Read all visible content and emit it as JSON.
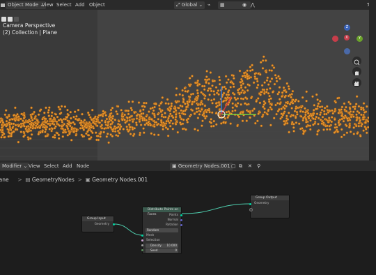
{
  "viewport_header": {
    "mode_label": "Object Mode",
    "menu": [
      "View",
      "Select",
      "Add",
      "Object"
    ],
    "transform_orientation": "Global"
  },
  "viewport": {
    "camera_label": "Camera Perspective",
    "collection_label": "(2) Collection | Plane",
    "gizmo": {
      "x": "X",
      "y": "Y",
      "z": "Z"
    },
    "point_color": "#e8962e",
    "background_color": "#434343"
  },
  "node_editor_header": {
    "editor_type": "Modifier",
    "menu": [
      "View",
      "Select",
      "Add",
      "Node"
    ],
    "node_tree_name": "Geometry Nodes.001"
  },
  "breadcrumb": [
    "Plane",
    "GeometryNodes",
    "Geometry Nodes.001"
  ],
  "nodes": {
    "group_input": {
      "title": "Group Input",
      "outputs": [
        "Geometry"
      ]
    },
    "distribute": {
      "title": "Distribute Points on Faces",
      "outputs": [
        "Points",
        "Normal",
        "Rotation"
      ],
      "mode": "Random",
      "inputs": [
        "Mesh",
        "Selection"
      ],
      "density_label": "Density",
      "density_value": "10.000",
      "seed_label": "Seed",
      "seed_value": "0"
    },
    "group_output": {
      "title": "Group Output",
      "inputs": [
        "Geometry"
      ]
    }
  },
  "colors": {
    "geometry_socket": "#00d6a3",
    "vector_socket": "#6363c7",
    "float_socket": "#a1a1a1",
    "bool_socket": "#cca6d6",
    "int_socket": "#598c5c",
    "link": "#4fd0b0"
  }
}
